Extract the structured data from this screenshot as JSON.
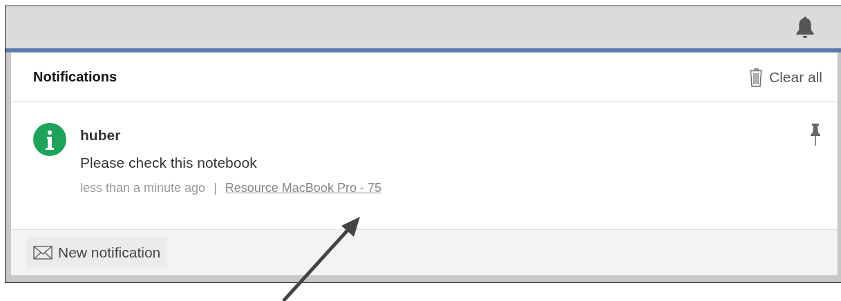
{
  "header": {
    "title": "Notifications",
    "clear_button": "Clear all"
  },
  "notifications": [
    {
      "author": "huber",
      "message": "Please check this notebook",
      "time": "less than a minute ago",
      "separator": "|",
      "link": "Resource MacBook Pro - 75"
    }
  ],
  "footer": {
    "new_button": "New notification"
  }
}
